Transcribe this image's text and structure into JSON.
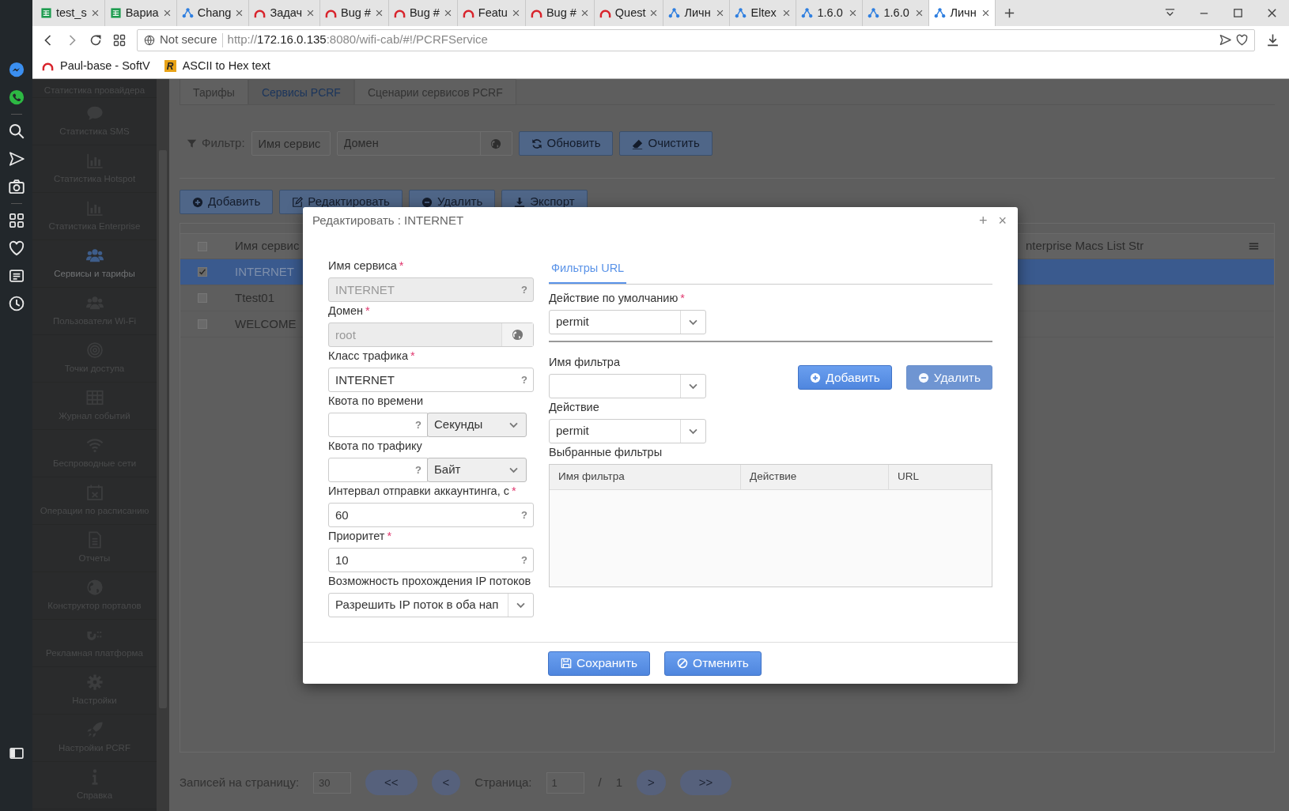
{
  "browser": {
    "tabs": [
      {
        "label": "test_s",
        "kind": "sheet",
        "selected": false
      },
      {
        "label": "Вариа",
        "kind": "sheet",
        "selected": false
      },
      {
        "label": "Chang",
        "kind": "network",
        "selected": false
      },
      {
        "label": "Задач",
        "kind": "arc",
        "selected": false
      },
      {
        "label": "Bug #",
        "kind": "arc",
        "selected": false
      },
      {
        "label": "Bug #",
        "kind": "arc",
        "selected": false
      },
      {
        "label": "Featu",
        "kind": "arc",
        "selected": false
      },
      {
        "label": "Bug #",
        "kind": "arc",
        "selected": false
      },
      {
        "label": "Quest",
        "kind": "arc",
        "selected": false
      },
      {
        "label": "Личн",
        "kind": "network",
        "selected": false
      },
      {
        "label": "Eltex",
        "kind": "network",
        "selected": false
      },
      {
        "label": "1.6.0",
        "kind": "network",
        "selected": false
      },
      {
        "label": "1.6.0",
        "kind": "network",
        "selected": false
      },
      {
        "label": "Личн",
        "kind": "network",
        "selected": true
      }
    ],
    "security": "Not secure",
    "url": "http://172.16.0.135:8080/wifi-cab/#!/PCRFService",
    "bookmarks": [
      {
        "label": "Paul-base - SoftV",
        "kind": "arc"
      },
      {
        "label": "ASCII to Hex text",
        "kind": "letter",
        "letter": "R"
      }
    ]
  },
  "sidebar": {
    "items": [
      {
        "label": "Статистика провайдера",
        "selected": false
      },
      {
        "label": "Статистика SMS",
        "selected": false
      },
      {
        "label": "Статистика Hotspot",
        "selected": false
      },
      {
        "label": "Статистика Enterprise",
        "selected": false
      },
      {
        "label": "Сервисы и тарифы",
        "selected": true
      },
      {
        "label": "Пользователи Wi-Fi",
        "selected": false
      },
      {
        "label": "Точки доступа",
        "selected": false
      },
      {
        "label": "Журнал событий",
        "selected": false
      },
      {
        "label": "Беспроводные сети",
        "selected": false
      },
      {
        "label": "Операции по расписанию",
        "selected": false
      },
      {
        "label": "Отчеты",
        "selected": false
      },
      {
        "label": "Конструктор порталов",
        "selected": false
      },
      {
        "label": "Рекламная платформа",
        "selected": false
      },
      {
        "label": "Настройки",
        "selected": false
      },
      {
        "label": "Настройки PCRF",
        "selected": false
      },
      {
        "label": "Справка",
        "selected": false
      }
    ]
  },
  "tabs": [
    {
      "label": "Тарифы",
      "selected": false
    },
    {
      "label": "Сервисы PCRF",
      "selected": true
    },
    {
      "label": "Сценарии сервисов PCRF",
      "selected": false
    }
  ],
  "filter": {
    "label": "Фильтр:",
    "name_placeholder": "Имя сервис",
    "domain_placeholder": "Домен",
    "buttons": [
      "Обновить",
      "Очистить"
    ]
  },
  "toolbar": [
    "Добавить",
    "Редактировать",
    "Удалить",
    "Экспорт"
  ],
  "table": {
    "header_checked": false,
    "columns": [
      "Имя сервис",
      "nterprise Macs List Str"
    ],
    "rows": [
      {
        "name": "INTERNET",
        "checked": true,
        "selected": true
      },
      {
        "name": "Ttest01",
        "checked": false,
        "selected": false
      },
      {
        "name": "WELCOME",
        "checked": false,
        "selected": false
      }
    ]
  },
  "pager": {
    "per_page_label": "Записей на страницу:",
    "per_page": "30",
    "first": "<<",
    "prev": "<",
    "page_label": "Страница:",
    "page": "1",
    "separator": "/",
    "total": "1",
    "next": ">",
    "last": ">>"
  },
  "modal": {
    "title": "Редактировать : INTERNET",
    "expand": "+",
    "close": "×",
    "fields": [
      {
        "kind": "text",
        "label": "Имя сервиса",
        "required_mark": "*",
        "value": "INTERNET",
        "help": "?",
        "disabled": true
      },
      {
        "kind": "globe",
        "label": "Домен",
        "required_mark": "*",
        "value": "root",
        "disabled": true
      },
      {
        "kind": "text",
        "label": "Класс трафика",
        "required_mark": "*",
        "value": "INTERNET",
        "help": "?",
        "disabled": false
      },
      {
        "kind": "quota",
        "label": "Квота по времени",
        "help": "?",
        "unit": "Секунды",
        "disabled": false
      },
      {
        "kind": "quota",
        "label": "Квота по трафику",
        "help": "?",
        "unit": "Байт",
        "disabled": false
      },
      {
        "kind": "text",
        "label": "Интервал отправки аккаунтинга, с",
        "required_mark": "*",
        "value": "60",
        "help": "?",
        "disabled": false
      },
      {
        "kind": "text",
        "label": "Приоритет",
        "required_mark": "*",
        "value": "10",
        "help": "?",
        "disabled": false
      },
      {
        "kind": "select",
        "label": "Возможность прохождения IP потоков",
        "value": "Разрешить IP поток в оба нап",
        "disabled": false
      }
    ],
    "tabs": [
      {
        "label": "Фильтры URL",
        "selected": true
      }
    ],
    "default_action": {
      "label": "Действие по умолчанию",
      "required_mark": "*",
      "value": "permit"
    },
    "filter_name": {
      "label": "Имя фильтра"
    },
    "action": {
      "label": "Действие",
      "value": "permit"
    },
    "buttons": [
      {
        "label": "Добавить",
        "disabled": false
      },
      {
        "label": "Удалить",
        "disabled": true
      }
    ],
    "selected_filters": {
      "label": "Выбранные фильтры",
      "columns": [
        "Имя фильтра",
        "Действие",
        "URL"
      ]
    },
    "footer": [
      "Сохранить",
      "Отменить"
    ]
  }
}
